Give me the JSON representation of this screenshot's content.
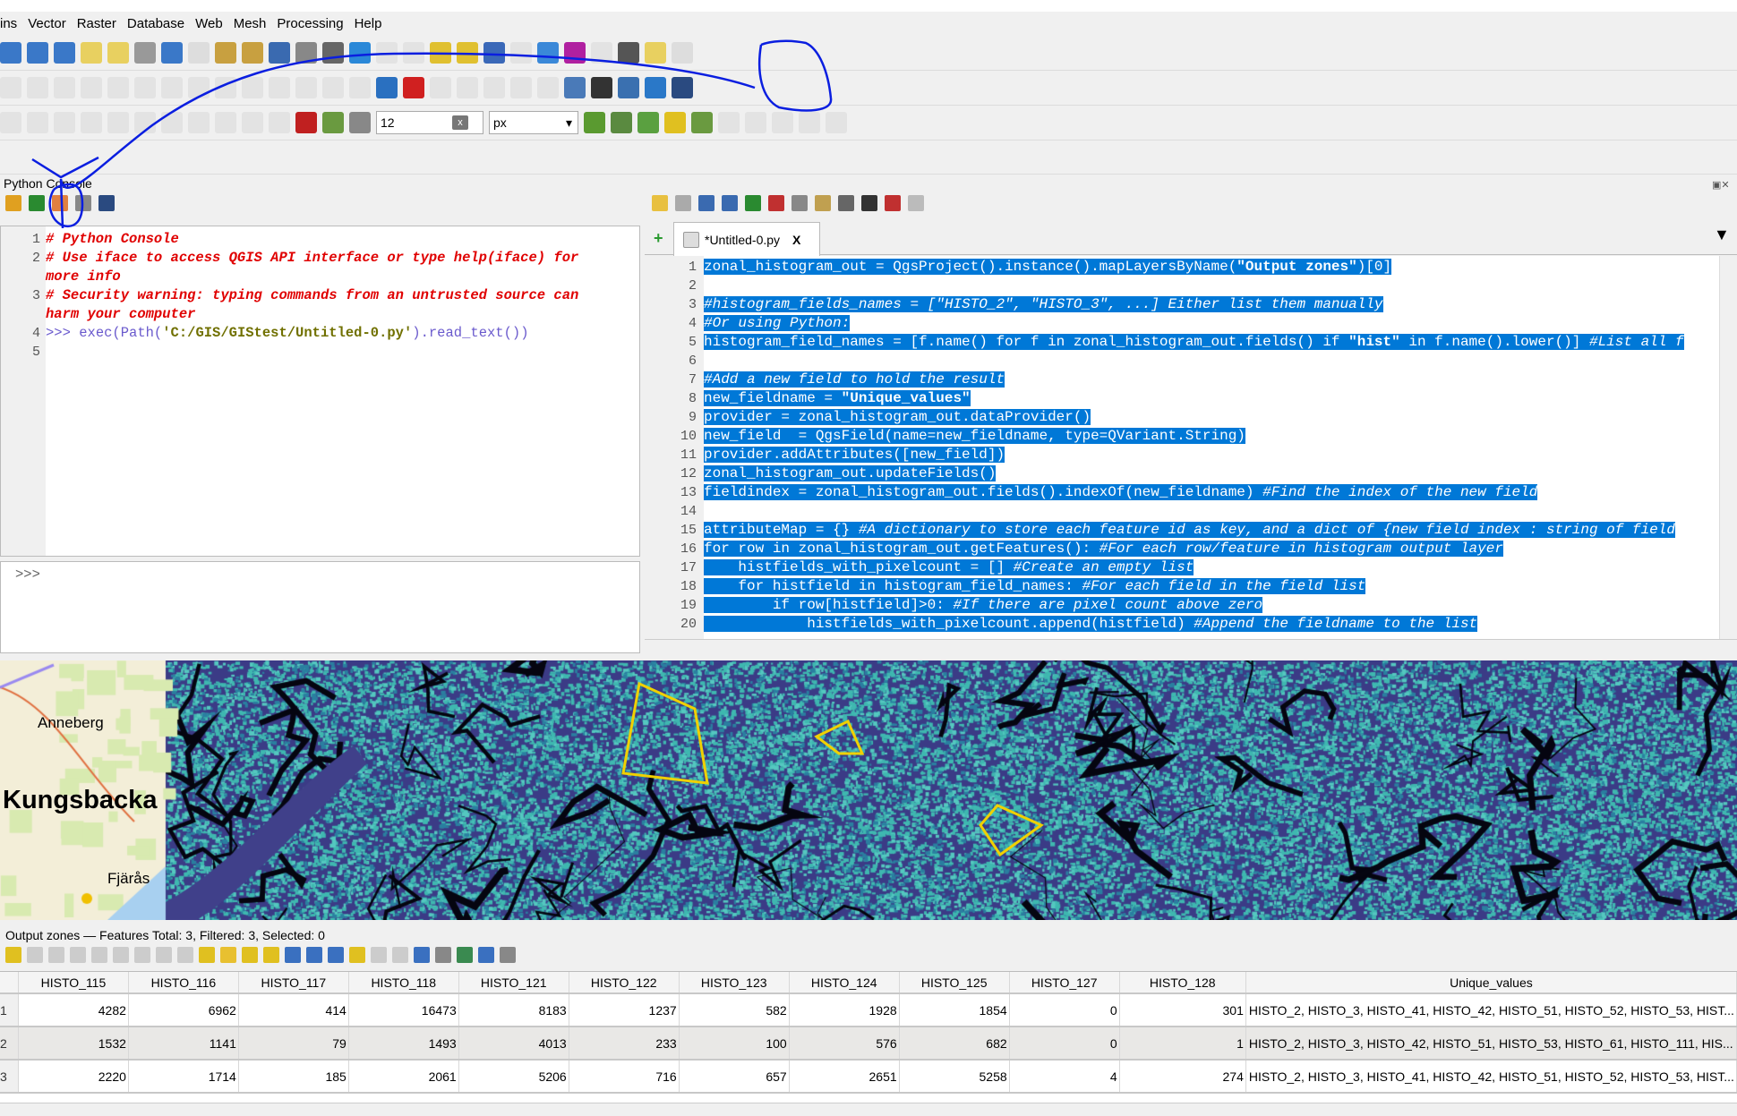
{
  "menu": [
    "ins",
    "Vector",
    "Raster",
    "Database",
    "Web",
    "Mesh",
    "Processing",
    "Help"
  ],
  "toolbars": {
    "row1": [
      [
        "zoom-in-icon",
        "#3a78c8"
      ],
      [
        "zoom-out-icon",
        "#3a78c8"
      ],
      [
        "zoom-full-icon",
        "#3a78c8"
      ],
      [
        "zoom-layer-icon",
        "#e8d060"
      ],
      [
        "zoom-selection-icon",
        "#e8d060"
      ],
      [
        "zoom-native-icon",
        "#999"
      ],
      [
        "zoom-last-icon",
        "#3a78c8"
      ],
      [
        "zoom-next-icon",
        "#bbb"
      ],
      [
        "new-bookmark-icon",
        "#c8a040"
      ],
      [
        "show-bookmarks-icon",
        "#c8a040"
      ],
      [
        "new-map-view-icon",
        "#3a6ab0"
      ],
      [
        "new-3d-view-icon",
        "#888"
      ],
      [
        "temporal-icon",
        "#666"
      ],
      [
        "refresh-icon",
        "#2a88d8"
      ],
      [
        "select-icon",
        "#ccc"
      ],
      [
        "deselect-icon",
        "#ccc"
      ],
      [
        "select-by-expression-icon",
        "#e0c030"
      ],
      [
        "select-location-icon",
        "#e0c030"
      ],
      [
        "identify-icon",
        "#3a68b8"
      ],
      [
        "attribute-table-icon",
        "#ccc"
      ],
      [
        "processing-toolbox-icon",
        "#3a88d8"
      ],
      [
        "statistics-sigma-icon",
        "#b020a0"
      ],
      [
        "field-calculator-icon",
        "#ccc"
      ],
      [
        "measure-icon",
        "#555"
      ],
      [
        "map-tips-icon",
        "#e8d060"
      ],
      [
        "plugin-icon",
        "#bbb"
      ]
    ],
    "row2": [
      [
        "edit-pencil-icon",
        "#ccc"
      ],
      [
        "save-edits-icon",
        "#ccc"
      ],
      [
        "digitize-icon",
        "#ccc"
      ],
      [
        "add-polygon-icon",
        "#ccc"
      ],
      [
        "vertex-tool-icon",
        "#ccc"
      ],
      [
        "modify-attributes-icon",
        "#ccc"
      ],
      [
        "delete-selected-icon",
        "#ccc"
      ],
      [
        "cut-icon",
        "#ccc"
      ],
      [
        "copy-icon",
        "#ccc"
      ],
      [
        "paste-icon",
        "#ccc"
      ],
      [
        "undo-icon",
        "#ccc"
      ],
      [
        "redo-icon",
        "#ccc"
      ],
      [
        "label-toolbar-icon",
        "#ccc"
      ],
      [
        "pin-label-icon",
        "#ccc"
      ],
      [
        "label-abc-icon",
        "#2a70c0"
      ],
      [
        "label-abc-red-icon",
        "#d02020"
      ],
      [
        "label-move-icon",
        "#ccc"
      ],
      [
        "label-show-icon",
        "#ccc"
      ],
      [
        "label-rotate-icon",
        "#ccc"
      ],
      [
        "label-change-icon",
        "#ccc"
      ],
      [
        "label-edit-icon",
        "#ccc"
      ],
      [
        "db-manager-icon",
        "#4a7ab8"
      ],
      [
        "metasearch-icon",
        "#333"
      ],
      [
        "python-console-icon",
        "#3a70b0"
      ],
      [
        "grass-icon",
        "#2a78c8"
      ],
      [
        "help-icon",
        "#2a4a80"
      ]
    ],
    "row3": [
      [
        "advanced-digitize-icon",
        "#ccc"
      ],
      [
        "split-icon",
        "#ccc"
      ],
      [
        "merge-icon",
        "#ccc"
      ],
      [
        "reshape-icon",
        "#ccc"
      ],
      [
        "offset-icon",
        "#ccc"
      ],
      [
        "simplify-icon",
        "#ccc"
      ],
      [
        "add-ring-icon",
        "#ccc"
      ],
      [
        "delete-ring-icon",
        "#ccc"
      ],
      [
        "add-part-icon",
        "#ccc"
      ],
      [
        "delete-part-icon",
        "#ccc"
      ],
      [
        "rotate-icon",
        "#ccc"
      ],
      [
        "snapping-magnet-icon",
        "#c02020"
      ],
      [
        "snap-vertex-icon",
        "#6a9a40"
      ],
      [
        "snap-mode-icon",
        "#888"
      ]
    ],
    "row3b": [
      [
        "trace-icon",
        "#5a9a30"
      ],
      [
        "topology-icon",
        "#5a8a40"
      ],
      [
        "intersection-icon",
        "#5aa040"
      ],
      [
        "self-snap-icon",
        "#e0c020"
      ],
      [
        "split-snap-icon",
        "#6a9a40"
      ],
      [
        "shape-digitize-1-icon",
        "#ccc"
      ],
      [
        "shape-digitize-2-icon",
        "#ccc"
      ],
      [
        "shape-digitize-3-icon",
        "#ccc"
      ],
      [
        "shape-digitize-4-icon",
        "#ccc"
      ],
      [
        "shape-digitize-5-icon",
        "#ccc"
      ]
    ],
    "snap_tolerance": "12",
    "snap_clear": "x",
    "snap_units": "px"
  },
  "python_console": {
    "title": "Python Console",
    "toolbar": [
      [
        "clear-console-icon",
        "#e0a020"
      ],
      [
        "run-command-icon",
        "#2a8a30"
      ],
      [
        "show-editor-icon",
        "#e08040"
      ],
      [
        "settings-wrench-icon",
        "#888"
      ],
      [
        "help-book-icon",
        "#2a4a80"
      ]
    ],
    "lines": [
      {
        "n": "1",
        "t": "# Python Console",
        "y": 0
      },
      {
        "n": "2",
        "t": "# Use iface to access QGIS API interface or type help(iface) for",
        "y": 1
      },
      {
        "n": "",
        "t": "more info",
        "y": 2
      },
      {
        "n": "3",
        "t": "# Security warning: typing commands from an untrusted source can",
        "y": 3
      },
      {
        "n": "",
        "t": "harm your computer",
        "y": 4
      }
    ],
    "exec_num": "4",
    "exec_prompt": ">>> ",
    "exec_pre": "exec(Path(",
    "exec_str": "'C:/GIS/GIStest/Untitled-0.py'",
    "exec_post": ").read_text())",
    "last_num": "5",
    "input_prompt": ">>>"
  },
  "editor": {
    "toolbar": [
      [
        "open-script-icon",
        "#e8c040"
      ],
      [
        "open-external-icon",
        "#aaa"
      ],
      [
        "save-icon",
        "#3a6ab0"
      ],
      [
        "save-as-icon",
        "#3a6ab0"
      ],
      [
        "run-script-icon",
        "#2a8a30"
      ],
      [
        "cut-icon",
        "#c03030"
      ],
      [
        "copy-icon",
        "#888"
      ],
      [
        "paste-icon",
        "#c0a050"
      ],
      [
        "find-icon",
        "#666"
      ],
      [
        "comment-icon",
        "#333"
      ],
      [
        "uncomment-icon",
        "#c03030"
      ],
      [
        "object-inspector-icon",
        "#bbb"
      ]
    ],
    "tab_label": "*Untitled-0.py",
    "tab_close": "X",
    "lines": [
      [
        [
          "zonal_histogram_out = QgsProject().instance().mapLayersByName(",
          ""
        ],
        [
          "\"Output zones\"",
          "s"
        ],
        [
          ")[0]",
          ""
        ]
      ],
      [],
      [
        [
          "#histogram_fields_names = [\"HISTO_2\", \"HISTO_3\", ...] Either list them manually",
          "c"
        ]
      ],
      [
        [
          "#Or using Python:",
          "c"
        ]
      ],
      [
        [
          "histogram_field_names = [f.name() for f in zonal_histogram_out.fields() if ",
          ""
        ],
        [
          "\"hist\"",
          "s"
        ],
        [
          " in f.name().lower()] ",
          ""
        ],
        [
          "#List all f",
          "c"
        ]
      ],
      [],
      [
        [
          "#Add a new field to hold the result",
          "c"
        ]
      ],
      [
        [
          "new_fieldname = ",
          ""
        ],
        [
          "\"Unique_values\"",
          "s"
        ]
      ],
      [
        [
          "provider = zonal_histogram_out.dataProvider()",
          ""
        ]
      ],
      [
        [
          "new_field  = QgsField(name=new_fieldname, type=QVariant.String)",
          ""
        ]
      ],
      [
        [
          "provider.addAttributes([new_field])",
          ""
        ]
      ],
      [
        [
          "zonal_histogram_out.updateFields()",
          ""
        ]
      ],
      [
        [
          "fieldindex = zonal_histogram_out.fields().indexOf(new_fieldname) ",
          ""
        ],
        [
          "#Find the index of the new field",
          "c"
        ]
      ],
      [],
      [
        [
          "attributeMap = {} ",
          ""
        ],
        [
          "#A dictionary to store each feature id as key, and a dict of {new field index : string of field",
          "c"
        ]
      ],
      [
        [
          "for row in zonal_histogram_out.getFeatures(): ",
          ""
        ],
        [
          "#For each row/feature in histogram output layer",
          "c"
        ]
      ],
      [
        [
          "    histfields_with_pixelcount = [] ",
          ""
        ],
        [
          "#Create an empty list",
          "c"
        ]
      ],
      [
        [
          "    for histfield in histogram_field_names: ",
          ""
        ],
        [
          "#For each field in the field list",
          "c"
        ]
      ],
      [
        [
          "        if row[histfield]>0: ",
          ""
        ],
        [
          "#If there are pixel count above zero",
          "c"
        ]
      ],
      [
        [
          "            histfields_with_pixelcount.append(histfield) ",
          ""
        ],
        [
          "#Append the fieldname to the list",
          "c"
        ]
      ]
    ]
  },
  "map": {
    "labels": {
      "anneberg": "Anneberg",
      "kungsbacka": "Kungsbacka",
      "fjaras": "Fjärås"
    },
    "colors": {
      "background": "#3b3b86",
      "speckle": "#3fb8b0",
      "shadow": "#050510",
      "zone_outline": "#f0d000"
    }
  },
  "attribute_table": {
    "title": "Output zones — Features Total: 3, Filtered: 3, Selected: 0",
    "toolbar": [
      [
        "toggle-editing-icon",
        "#e0c020"
      ],
      [
        "multi-edit-icon",
        "#ccc"
      ],
      [
        "save-edits-icon",
        "#ccc"
      ],
      [
        "reload-icon",
        "#ccc"
      ],
      [
        "add-feature-icon",
        "#ccc"
      ],
      [
        "delete-feature-icon",
        "#ccc"
      ],
      [
        "cut-icon",
        "#ccc"
      ],
      [
        "copy-icon",
        "#ccc"
      ],
      [
        "paste-icon",
        "#ccc"
      ],
      [
        "select-expression-icon",
        "#e0c020"
      ],
      [
        "select-all-icon",
        "#e8c030"
      ],
      [
        "invert-selection-icon",
        "#e0c020"
      ],
      [
        "deselect-icon",
        "#e0c020"
      ],
      [
        "filter-select-icon",
        "#3a70c0"
      ],
      [
        "move-selection-top-icon",
        "#3a70c0"
      ],
      [
        "pan-selected-icon",
        "#3a70c0"
      ],
      [
        "zoom-selected-icon",
        "#e0c020"
      ],
      [
        "new-field-icon",
        "#ccc"
      ],
      [
        "delete-field-icon",
        "#ccc"
      ],
      [
        "field-calculator-icon",
        "#3a70c0"
      ],
      [
        "conditional-formatting-icon",
        "#888"
      ],
      [
        "actions-icon",
        "#3a8a50"
      ],
      [
        "dock-icon",
        "#3a70c0"
      ],
      [
        "table-view-icon",
        "#888"
      ]
    ],
    "columns": [
      "HISTO_115",
      "HISTO_116",
      "HISTO_117",
      "HISTO_118",
      "HISTO_121",
      "HISTO_122",
      "HISTO_123",
      "HISTO_124",
      "HISTO_125",
      "HISTO_127",
      "HISTO_128",
      "Unique_values"
    ],
    "rows": [
      {
        "id": "1",
        "values": [
          "4282",
          "6962",
          "414",
          "16473",
          "8183",
          "1237",
          "582",
          "1928",
          "1854",
          "0",
          "301",
          "HISTO_2, HISTO_3, HISTO_41, HISTO_42, HISTO_51, HISTO_52, HISTO_53, HIST..."
        ]
      },
      {
        "id": "2",
        "values": [
          "1532",
          "1141",
          "79",
          "1493",
          "4013",
          "233",
          "100",
          "576",
          "682",
          "0",
          "1",
          "HISTO_2, HISTO_3, HISTO_42, HISTO_51, HISTO_53, HISTO_61, HISTO_111, HIS..."
        ]
      },
      {
        "id": "3",
        "values": [
          "2220",
          "1714",
          "185",
          "2061",
          "5206",
          "716",
          "657",
          "2651",
          "5258",
          "4",
          "274",
          "HISTO_2, HISTO_3, HISTO_41, HISTO_42, HISTO_51, HISTO_52, HISTO_53, HIST..."
        ]
      }
    ]
  }
}
